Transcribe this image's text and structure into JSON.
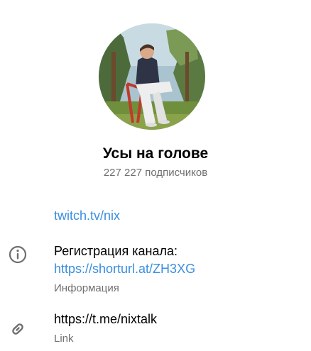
{
  "channel": {
    "name": "Усы на голове",
    "subscribers": "227 227 подписчиков"
  },
  "links": {
    "twitch": "twitch.tv/nix"
  },
  "info": {
    "icon": "info-icon",
    "registration_prefix": "Регистрация канала: ",
    "registration_link": "https://shorturl.at/ZH3XG",
    "label": "Информация"
  },
  "share_link": {
    "icon": "link-icon",
    "url": "https://t.me/nixtalk",
    "label": "Link"
  },
  "colors": {
    "link": "#3a8ee0",
    "secondary_text": "#6f6f6f"
  }
}
